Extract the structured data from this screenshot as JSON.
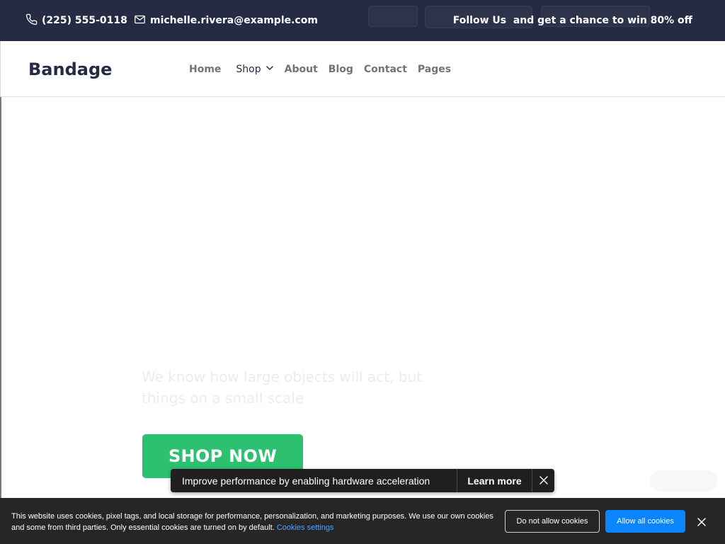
{
  "topbar": {
    "phone": "(225) 555-0118",
    "email": "michelle.rivera@example.com",
    "promo": "Follow Us  and get a chance to win 80% off"
  },
  "nav": {
    "brand": "Bandage",
    "links": {
      "home": "Home",
      "shop": "Shop",
      "about": "About",
      "blog": "Blog",
      "contact": "Contact",
      "pages": "Pages"
    }
  },
  "hero": {
    "description": "We know how large objects will act, but things on a small scale",
    "cta": "SHOP NOW"
  },
  "toast": {
    "message": "Improve performance by enabling hardware acceleration",
    "action": "Learn more"
  },
  "cookie": {
    "text": "This website uses cookies, pixel tags, and local storage for performance, personalization, and marketing purposes. We use our own cookies and some from third parties. Only essential cookies are turned on by default.",
    "settings_link": "Cookies settings",
    "deny": "Do not allow cookies",
    "allow": "Allow all cookies"
  },
  "colors": {
    "topbar": "#252b42",
    "brand": "#252b42",
    "nav_link": "#737373",
    "cta": "#2dc071",
    "allow_button": "#0b84ff",
    "cookie_bg": "#262626",
    "toast_bg": "#1f1f1f"
  },
  "icons": {
    "phone": "phone-icon",
    "email": "mail-icon",
    "shop_dropdown": "chevron-down-icon",
    "toast_close": "close-icon",
    "cookie_close": "close-icon"
  }
}
